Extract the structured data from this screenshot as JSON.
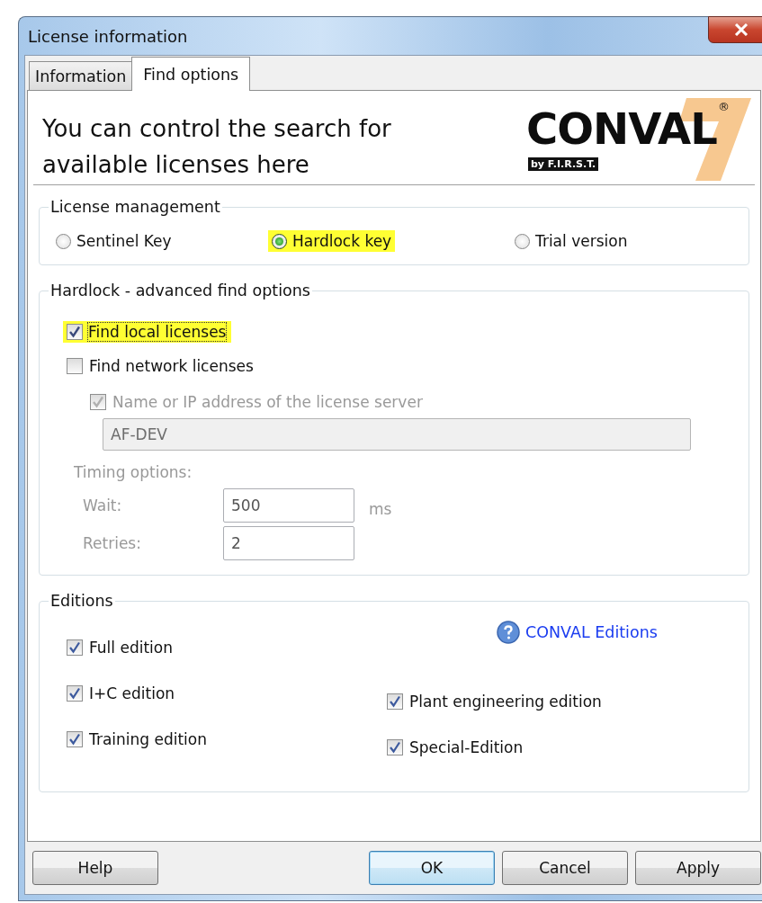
{
  "window": {
    "title": "License information"
  },
  "tabs": [
    {
      "label": "Information",
      "selected": false
    },
    {
      "label": "Find options",
      "selected": true
    }
  ],
  "header": {
    "lines": [
      "You can control the search for",
      "available licenses here"
    ],
    "logo": {
      "name": "CONVAL",
      "mark": "®",
      "tagline": "by F.I.R.S.T."
    }
  },
  "license_management": {
    "title": "License management",
    "options": [
      {
        "label": "Sentinel Key",
        "selected": false,
        "highlighted": false
      },
      {
        "label": "Hardlock key",
        "selected": true,
        "highlighted": true
      },
      {
        "label": "Trial version",
        "selected": false,
        "highlighted": false
      }
    ]
  },
  "hardlock": {
    "title": "Hardlock - advanced find options",
    "find_local": {
      "label": "Find local licenses",
      "checked": true,
      "highlighted": true,
      "focused": true
    },
    "find_network": {
      "label": "Find network licenses",
      "checked": false,
      "highlighted": false,
      "focused": false
    },
    "server": {
      "label": "Name or IP address of the license server",
      "checked": true,
      "disabled": true,
      "value": "AF-DEV"
    },
    "timing": {
      "title": "Timing options:",
      "disabled": true,
      "wait": {
        "label": "Wait:",
        "value": "500",
        "unit": "ms"
      },
      "retries": {
        "label": "Retries:",
        "value": "2"
      }
    }
  },
  "editions": {
    "title": "Editions",
    "link": "CONVAL Editions",
    "left": [
      {
        "label": "Full edition",
        "checked": true
      },
      {
        "label": "I+C edition",
        "checked": true
      },
      {
        "label": "Training edition",
        "checked": true
      }
    ],
    "right": [
      {
        "label": "Plant engineering edition",
        "checked": true
      },
      {
        "label": "Special-Edition",
        "checked": true
      }
    ]
  },
  "buttons": [
    {
      "label": "Help",
      "default": false
    },
    {
      "label": "OK",
      "default": true
    },
    {
      "label": "Cancel",
      "default": false
    },
    {
      "label": "Apply",
      "default": false
    }
  ]
}
